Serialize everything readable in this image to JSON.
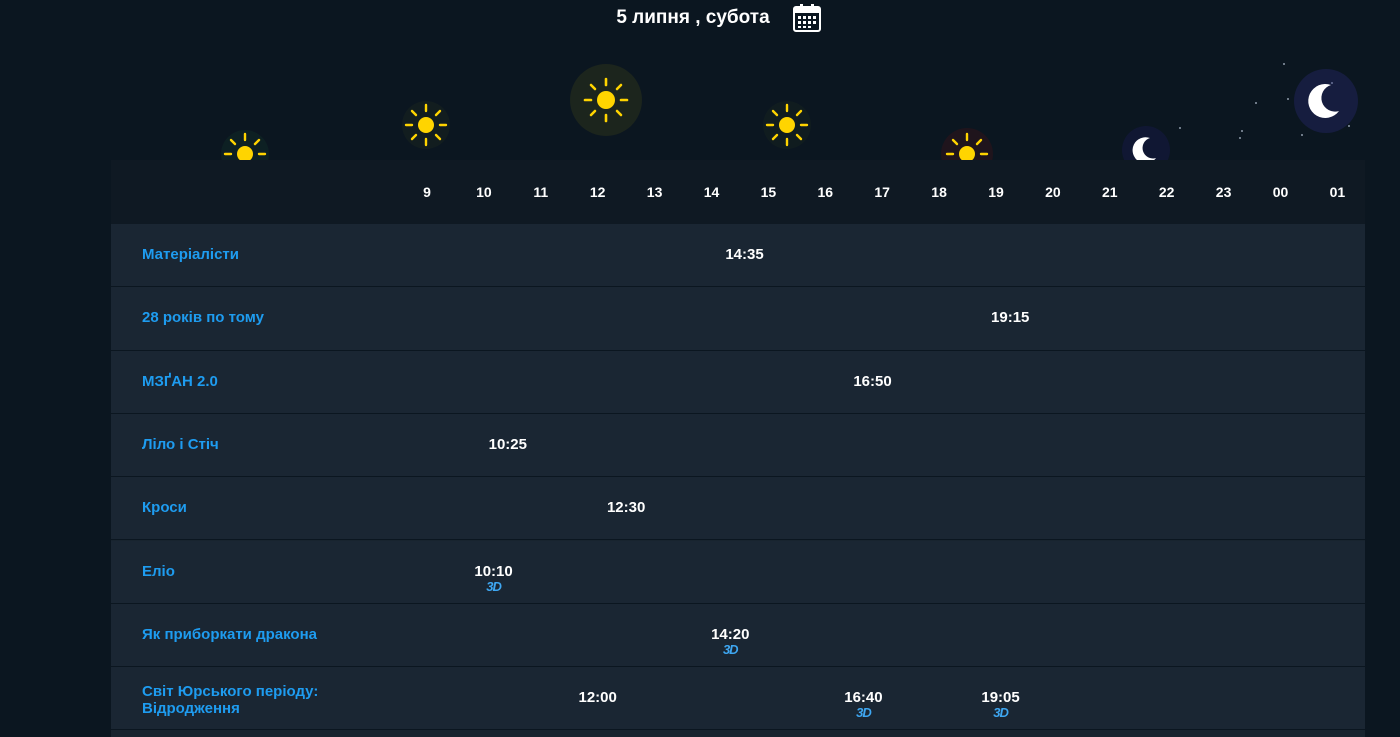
{
  "header": {
    "date": "5 липня , субота",
    "calendar_icon": "calendar-icon"
  },
  "hours": [
    "9",
    "10",
    "11",
    "12",
    "13",
    "14",
    "15",
    "16",
    "17",
    "18",
    "19",
    "20",
    "21",
    "22",
    "23",
    "00",
    "01"
  ],
  "movies": [
    {
      "title": "Матеріалісти",
      "sessions": [
        {
          "time": "14:35",
          "hour": 14.58,
          "format": ""
        }
      ]
    },
    {
      "title": "28 років по тому",
      "sessions": [
        {
          "time": "19:15",
          "hour": 19.25,
          "format": ""
        }
      ]
    },
    {
      "title": "МЗҐАН 2.0",
      "sessions": [
        {
          "time": "16:50",
          "hour": 16.83,
          "format": ""
        }
      ]
    },
    {
      "title": "Ліло і Стіч",
      "sessions": [
        {
          "time": "10:25",
          "hour": 10.42,
          "format": ""
        }
      ]
    },
    {
      "title": "Кроси",
      "sessions": [
        {
          "time": "12:30",
          "hour": 12.5,
          "format": ""
        }
      ]
    },
    {
      "title": "Еліо",
      "sessions": [
        {
          "time": "10:10",
          "hour": 10.17,
          "format": "3D"
        }
      ]
    },
    {
      "title": "Як приборкати дракона",
      "sessions": [
        {
          "time": "14:20",
          "hour": 14.33,
          "format": "3D"
        }
      ]
    },
    {
      "title": "Світ Юрського періоду: Відродження",
      "sessions": [
        {
          "time": "12:00",
          "hour": 12.0,
          "format": ""
        },
        {
          "time": "16:40",
          "hour": 16.67,
          "format": "3D"
        },
        {
          "time": "19:05",
          "hour": 19.08,
          "format": "3D"
        }
      ]
    }
  ],
  "colors": {
    "background": "#0b1620",
    "title_link": "#1e9cf0",
    "badge_3d": "#3ea7f2",
    "sun": "#ffd400"
  }
}
